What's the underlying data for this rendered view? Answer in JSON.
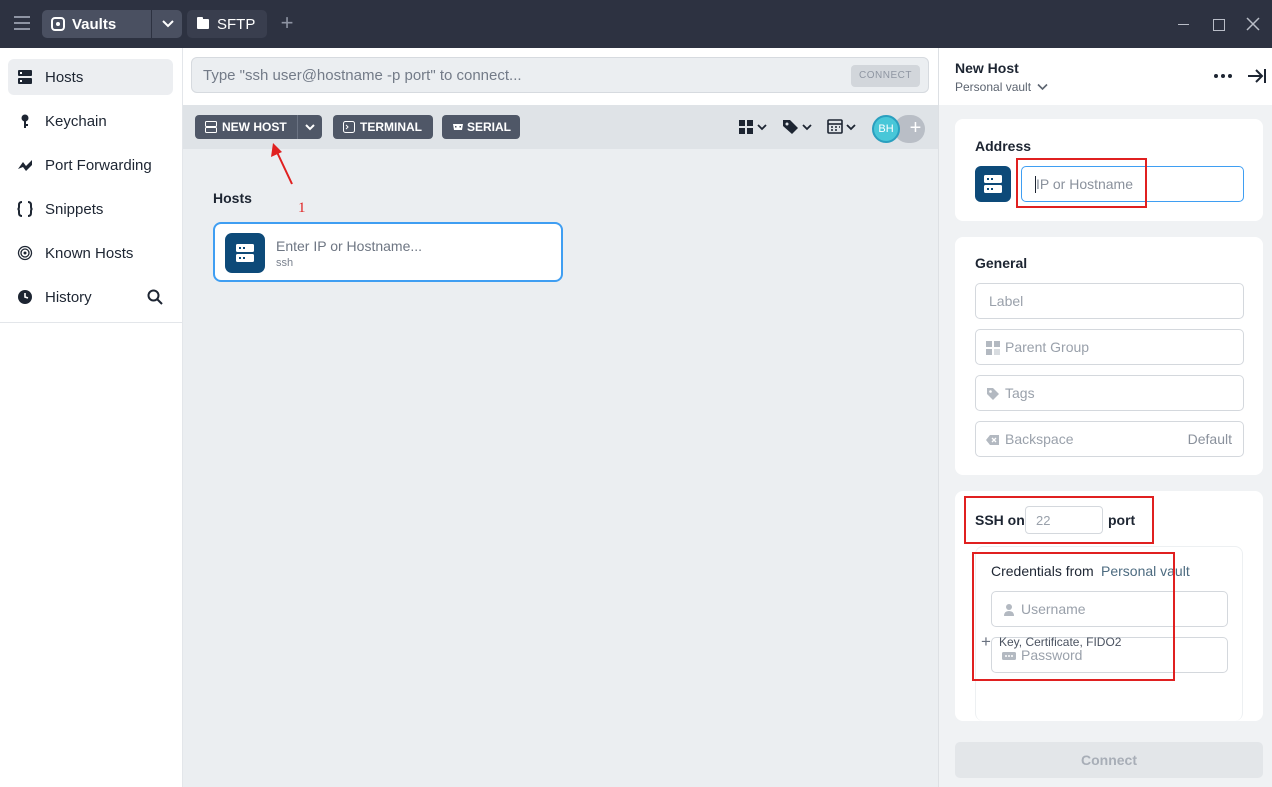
{
  "titlebar": {
    "vault_tab": "Vaults",
    "sftp_tab": "SFTP"
  },
  "sidebar": {
    "items": [
      {
        "label": "Hosts",
        "icon": "hosts-icon",
        "active": true
      },
      {
        "label": "Keychain",
        "icon": "key-icon"
      },
      {
        "label": "Port Forwarding",
        "icon": "port-forwarding-icon"
      },
      {
        "label": "Snippets",
        "icon": "snippets-icon"
      },
      {
        "label": "Known Hosts",
        "icon": "fingerprint-icon"
      },
      {
        "label": "History",
        "icon": "clock-icon"
      }
    ]
  },
  "main": {
    "command_placeholder": "Type \"ssh user@hostname -p port\" to connect...",
    "connect_pill": "CONNECT",
    "toolbar": {
      "new_host": "NEW HOST",
      "terminal": "TERMINAL",
      "serial": "SERIAL"
    },
    "avatar_initials": "BH",
    "section_title": "Hosts",
    "annotation_number": "1",
    "host_card": {
      "title": "Enter IP or Hostname...",
      "protocol": "ssh"
    }
  },
  "panel": {
    "title": "New Host",
    "vault": "Personal vault",
    "address": {
      "label": "Address",
      "placeholder": "IP or Hostname"
    },
    "general": {
      "label": "General",
      "label_placeholder": "Label",
      "parent_group_placeholder": "Parent Group",
      "tags_placeholder": "Tags",
      "backspace_placeholder": "Backspace",
      "backspace_value": "Default"
    },
    "ssh": {
      "on_label": "SSH on",
      "port_placeholder": "22",
      "port_label": "port",
      "credentials_from": "Credentials from",
      "credentials_vault": "Personal vault",
      "username_placeholder": "Username",
      "password_placeholder": "Password",
      "add_key": "Key, Certificate, FIDO2"
    },
    "connect_button": "Connect"
  },
  "colors": {
    "titlebar": "#2d3241",
    "accent_blue": "#3f9ef2",
    "host_icon_bg": "#0d4a79",
    "annotation_red": "#e02020"
  }
}
